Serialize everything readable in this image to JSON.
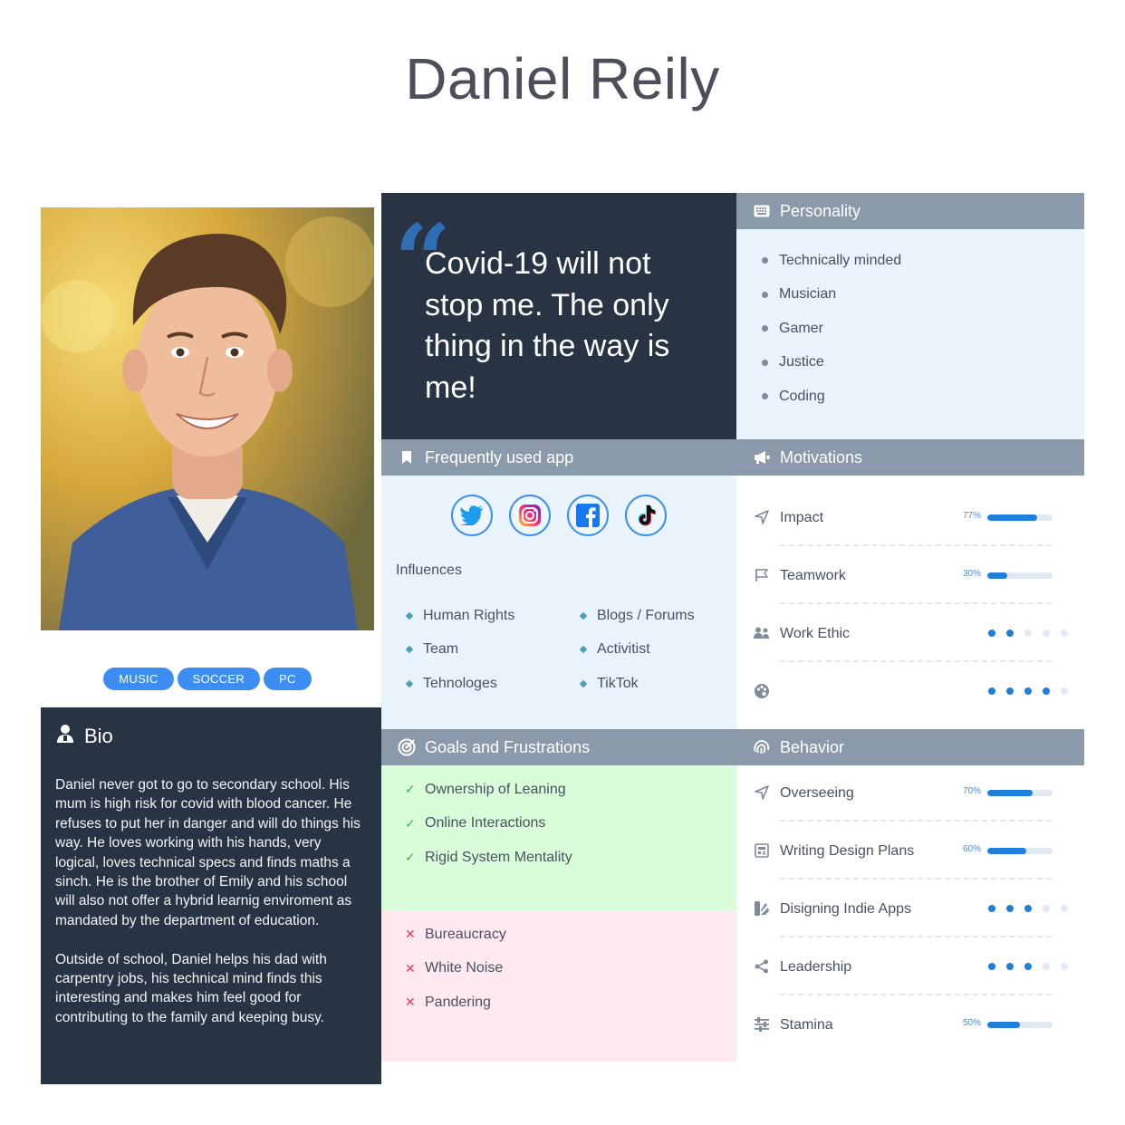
{
  "persona": {
    "name": "Daniel Reily",
    "tags": [
      "MUSIC",
      "SOCCER",
      "PC"
    ],
    "quote": "Covid-19 will not stop me. The only thing in the way is me!"
  },
  "bio": {
    "title": "Bio",
    "paragraphs": [
      "Daniel never got to go to secondary school. His mum is high risk for covid with blood cancer. He refuses to put her in danger and will do things his way. He loves working with his hands, very logical, loves technical specs and finds maths a sinch. He is the brother of Emily and his school will also not offer a hybrid learnig enviroment as mandated by the department of education.",
      "Outside of school, Daniel helps his dad with carpentry jobs, his technical mind finds this interesting and makes him feel good for contributing to the family and keeping busy."
    ]
  },
  "personality": {
    "title": "Personality",
    "items": [
      "Technically minded",
      "Musician",
      "Gamer",
      "Justice",
      "Coding"
    ]
  },
  "apps": {
    "title": "Frequently used app",
    "icons": [
      "twitter-icon",
      "instagram-icon",
      "facebook-icon",
      "tiktok-icon"
    ],
    "influences_label": "Influences",
    "influences_left": [
      "Human Rights",
      "Team",
      "Tehnologes"
    ],
    "influences_right": [
      "Blogs / Forums",
      "Activitist",
      "TikTok"
    ]
  },
  "motivations": {
    "title": "Motivations",
    "rows": [
      {
        "label": "Impact",
        "type": "bar",
        "percent": 77,
        "percent_label": "77%",
        "icon": "navigation-arrow-icon"
      },
      {
        "label": "Teamwork",
        "type": "bar",
        "percent": 30,
        "percent_label": "30%",
        "icon": "flag-icon"
      },
      {
        "label": "Work Ethic",
        "type": "dots",
        "level": 2,
        "max": 5,
        "icon": "people-icon"
      },
      {
        "label": "",
        "type": "dots",
        "level": 4,
        "max": 5,
        "icon": "palette-icon"
      }
    ]
  },
  "goals": {
    "title": "Goals and Frustrations",
    "goals": [
      "Ownership of Leaning",
      "Online Interactions",
      "Rigid System Mentality"
    ],
    "frustrations": [
      "Bureaucracy",
      "White Noise",
      "Pandering"
    ]
  },
  "behavior": {
    "title": "Behavior",
    "rows": [
      {
        "label": "Overseeing",
        "type": "bar",
        "percent": 70,
        "percent_label": "70%",
        "icon": "navigation-arrow-icon"
      },
      {
        "label": "Writing Design Plans",
        "type": "bar",
        "percent": 60,
        "percent_label": "60%",
        "icon": "newspaper-icon"
      },
      {
        "label": "Disigning Indie Apps",
        "type": "dots",
        "level": 3,
        "max": 5,
        "icon": "design-icon"
      },
      {
        "label": "Leadership",
        "type": "dots",
        "level": 3,
        "max": 5,
        "icon": "share-icon"
      },
      {
        "label": "Stamina",
        "type": "bar",
        "percent": 50,
        "percent_label": "50%",
        "icon": "sliders-icon"
      }
    ]
  },
  "colors": {
    "accent": "#3c8ef3",
    "dark_panel": "#283444",
    "header_gray": "#8a9aab"
  }
}
